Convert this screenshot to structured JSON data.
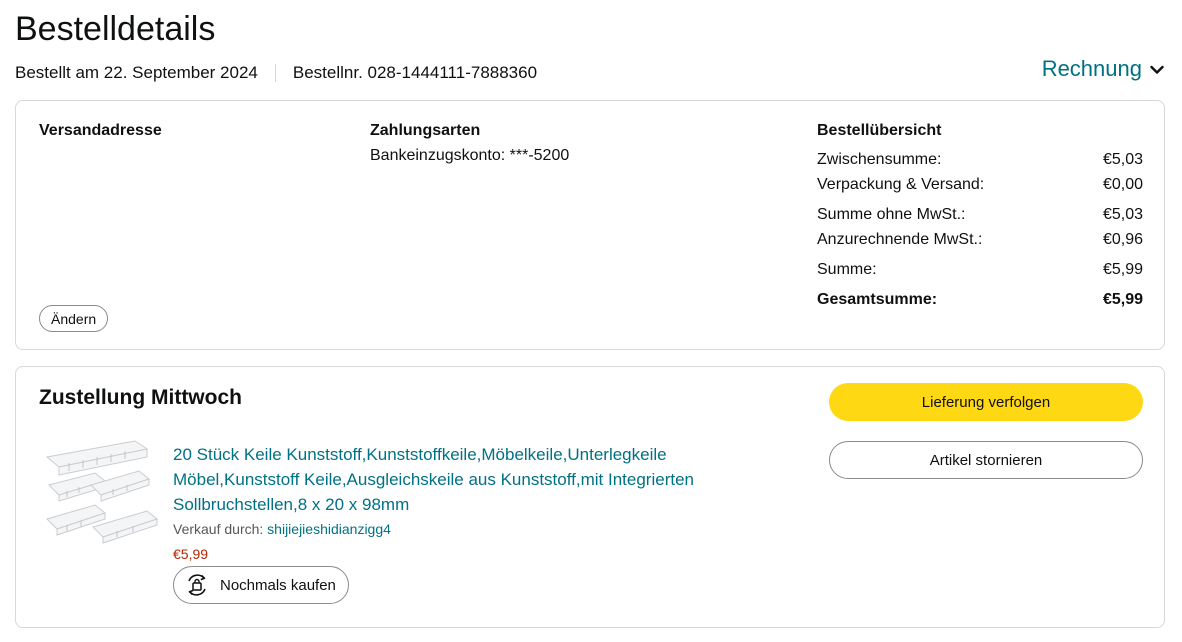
{
  "page": {
    "title": "Bestelldetails",
    "order_date": "Bestellt am 22. September 2024",
    "order_number": "Bestellnr. 028-1444111-7888360",
    "invoice_label": "Rechnung"
  },
  "info": {
    "shipping_heading": "Versandadresse",
    "change_button": "Ändern",
    "payment_heading": "Zahlungsarten",
    "payment_method": "Bankeinzugskonto: ***-5200",
    "summary_heading": "Bestellübersicht",
    "summary_rows": [
      {
        "label": "Zwischensumme:",
        "value": "€5,03"
      },
      {
        "label": "Verpackung & Versand:",
        "value": "€0,00"
      },
      {
        "label": "Summe ohne MwSt.:",
        "value": "€5,03"
      },
      {
        "label": "Anzurechnende MwSt.:",
        "value": "€0,96"
      },
      {
        "label": "Summe:",
        "value": "€5,99"
      },
      {
        "label": "Gesamtsumme:",
        "value": "€5,99"
      }
    ]
  },
  "delivery": {
    "heading": "Zustellung Mittwoch",
    "track_button": "Lieferung verfolgen",
    "cancel_button": "Artikel stornieren",
    "item": {
      "title": "20 Stück Keile Kunststoff,Kunststoffkeile,Möbelkeile,Unterlegkeile Möbel,Kunststoff Keile,Ausgleichskeile aus Kunststoff,mit Integrierten Sollbruchstellen,8 x 20 x 98mm",
      "seller_label": "Verkauf durch: ",
      "seller_name": "shijiejieshidianzigg4",
      "price": "€5,99",
      "rebuy_button": "Nochmals kaufen"
    }
  },
  "colors": {
    "link": "#007185",
    "price": "#b12704",
    "primary_button": "#ffd814",
    "border": "#d5d9d9"
  }
}
